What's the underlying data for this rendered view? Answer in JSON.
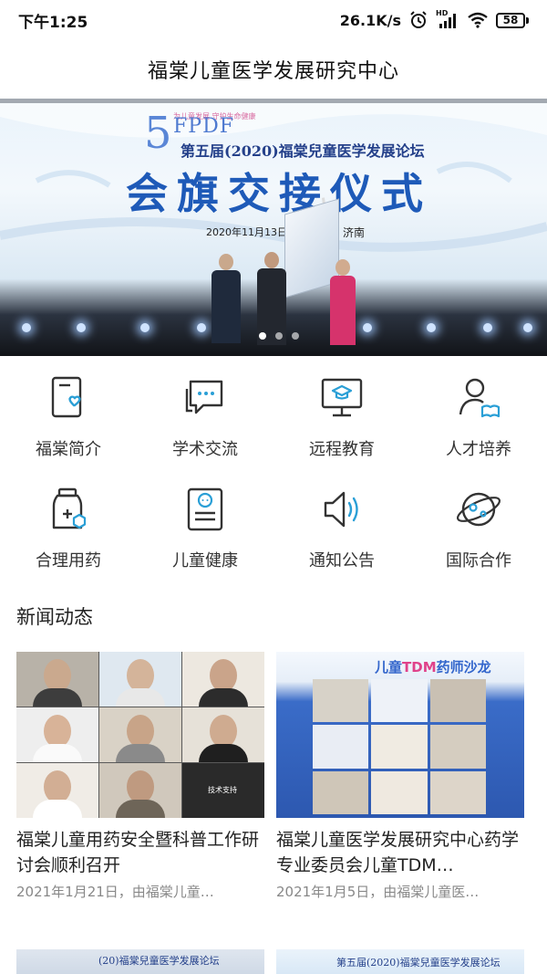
{
  "status_bar": {
    "time": "下午1:25",
    "network_speed": "26.1K/s",
    "network_badge": "HD",
    "battery": "58"
  },
  "header": {
    "title": "福棠儿童医学发展研究中心"
  },
  "banner": {
    "edition_number": "5",
    "brand": "FPDF",
    "slogan": "为儿童发展 守护生命健康",
    "forum_title": "第五届(2020)福棠兒童医学发展论坛",
    "ceremony_title": "会旗交接仪式",
    "date_range": "2020年11月13日 -15日",
    "city": "济南",
    "slide_count": 3,
    "active_slide": 1
  },
  "nav_items": [
    {
      "label": "福棠简介",
      "icon": "phone-heart-icon"
    },
    {
      "label": "学术交流",
      "icon": "chat-bubbles-icon"
    },
    {
      "label": "远程教育",
      "icon": "monitor-graduation-icon"
    },
    {
      "label": "人才培养",
      "icon": "person-book-icon"
    },
    {
      "label": "合理用药",
      "icon": "medicine-bottle-icon"
    },
    {
      "label": "儿童健康",
      "icon": "child-document-icon"
    },
    {
      "label": "通知公告",
      "icon": "speaker-icon"
    },
    {
      "label": "国际合作",
      "icon": "planet-icon"
    }
  ],
  "news": {
    "heading": "新闻动态",
    "items": [
      {
        "title": "福棠儿童用药安全暨科普工作研讨会顺利召开",
        "meta": "2021年1月21日，由福棠儿童…",
        "thumb_label": "技术支持"
      },
      {
        "title": "福棠儿童医学发展研究中心药学专业委员会儿童TDM…",
        "meta": "2021年1月5日，由福棠儿童医…",
        "thumb_title_a": "儿童",
        "thumb_title_b": "TDM",
        "thumb_title_c": "药师沙龙"
      }
    ],
    "peek_right_text": "第五届(2020)福棠兒童医学发展论坛",
    "peek_left_text": "(20)福棠兒童医学发展论坛"
  },
  "colors": {
    "accent": "#2a9fd6",
    "icon_stroke": "#333333",
    "banner_blue": "#1e5ab8"
  }
}
